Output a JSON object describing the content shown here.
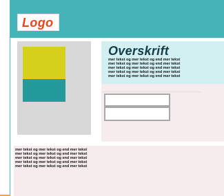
{
  "header": {
    "logo_text": "Logo"
  },
  "main": {
    "heading": "Overskrift",
    "top_paragraph": "mer tekst og mer tekst og end mer tekst\nmer tekst og mer tekst og end mer tekst\nmer tekst og mer tekst og end mer tekst\nmer tekst og mer tekst og end mer tekst\nmer tekst og mer tekst og end mer tekst",
    "bottom_paragraph": "mer tekst og mer tekst og end mer tekst\nmer tekst og mer tekst og end mer tekst\nmer tekst og mer tekst og end mer tekst\nmer tekst og mer tekst og end mer tekst\nmer tekst og mer tekst og end mer tekst",
    "fields": [
      {
        "value": ""
      },
      {
        "value": ""
      }
    ]
  },
  "colors": {
    "header_bg": "#45b4b8",
    "logo": "#e8461a",
    "heading": "#133c46",
    "top_panel": "#d2eff2",
    "pink_panel": "#f7eced",
    "image_placeholder": "#d8d8d8",
    "block_yellow": "#d5d01a",
    "block_teal": "#239a9c"
  }
}
